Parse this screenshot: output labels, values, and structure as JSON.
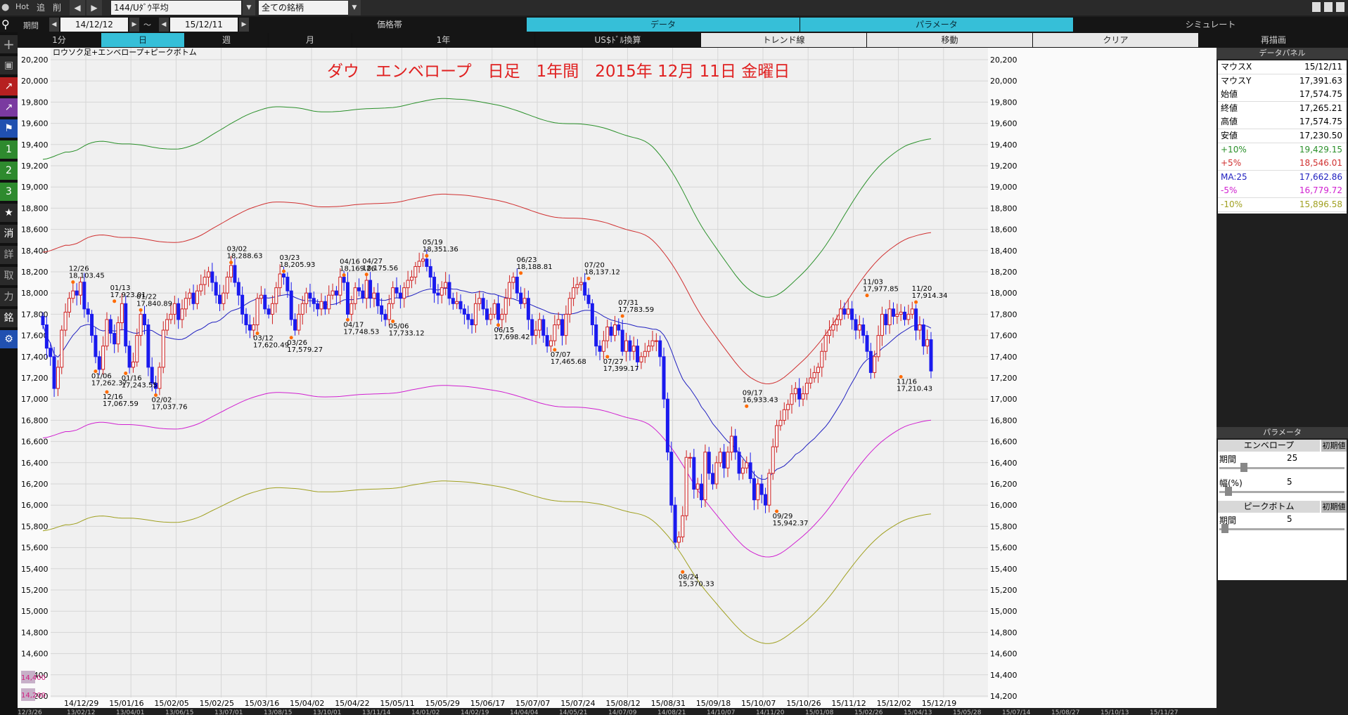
{
  "toolbar": {
    "hot": "Hot",
    "add": "追",
    "del": "削",
    "kikan": "期間",
    "date_from": "14/12/12",
    "tilde": "～",
    "date_to": "15/12/11",
    "symbol": "144/Uﾀﾞｳ平均",
    "universe": "全ての銘柄",
    "top_tabs": [
      "価格帯",
      "データ",
      "パラメータ",
      "シミュレート"
    ],
    "period_tabs": [
      "1分",
      "日",
      "週",
      "月",
      "1年",
      "US$ﾄﾞﾙ換算",
      "トレンド線",
      "移動",
      "クリア",
      "再描画"
    ]
  },
  "colors": {
    "accent": "#2fb8d2",
    "up": "#d02020",
    "down": "#1a1aee",
    "env10": "#2a902a",
    "env5": "#d03030",
    "ma": "#2020c0",
    "envm5": "#d020d0",
    "envm10": "#a0a020",
    "title": "#e02020"
  },
  "chart": {
    "legend": "ロウソク足+エンベロープ+ピークボトム",
    "title": "ダウ　エンベロープ　日足　1年間　2015年 12月 11日 金曜日",
    "y_ticks": [
      "20,200",
      "20,000",
      "19,800",
      "19,600",
      "19,400",
      "19,200",
      "19,000",
      "18,800",
      "18,600",
      "18,400",
      "18,200",
      "18,000",
      "17,800",
      "17,600",
      "17,400",
      "17,200",
      "17,000",
      "16,800",
      "16,600",
      "16,400",
      "16,200",
      "16,000",
      "15,800",
      "15,600",
      "15,400",
      "15,200",
      "15,000",
      "14,800",
      "14,600",
      "14,400",
      "14,200"
    ],
    "x_ticks": [
      "14/12/29",
      "15/01/16",
      "15/02/05",
      "15/02/25",
      "15/03/16",
      "15/04/02",
      "15/04/22",
      "15/05/11",
      "15/05/29",
      "15/06/17",
      "15/07/07",
      "15/07/24",
      "15/08/12",
      "15/08/31",
      "15/09/18",
      "15/10/07",
      "15/10/26",
      "15/11/12",
      "15/12/02",
      "15/12/19"
    ],
    "overview_ticks": [
      "12/3/26",
      "13/02/12",
      "13/04/01",
      "13/06/15",
      "13/07/01",
      "13/08/15",
      "13/10/01",
      "13/11/14",
      "14/01/02",
      "14/02/19",
      "14/04/04",
      "14/05/21",
      "14/07/09",
      "14/08/21",
      "14/10/07",
      "14/11/20",
      "15/01/08",
      "15/02/26",
      "15/04/13",
      "15/05/28",
      "15/07/14",
      "15/08/27",
      "15/10/13",
      "15/11/27"
    ],
    "scroll_labels": [
      "14,400",
      "14,200"
    ]
  },
  "chart_data": {
    "type": "candlestick",
    "ylim": [
      14200,
      20300
    ],
    "annotations": [
      {
        "d": "12/16",
        "v": "17,067.59",
        "x": 17,
        "y": 17067,
        "p": "b"
      },
      {
        "d": "12/26",
        "v": "18,103.45",
        "x": 8,
        "y": 18103,
        "p": "t"
      },
      {
        "d": "01/06",
        "v": "17,262.37",
        "x": 14,
        "y": 17262,
        "p": "b"
      },
      {
        "d": "01/13",
        "v": "17,923.01",
        "x": 19,
        "y": 17923,
        "p": "t"
      },
      {
        "d": "01/16",
        "v": "17,243.55",
        "x": 22,
        "y": 17243,
        "p": "b"
      },
      {
        "d": "01/22",
        "v": "17,840.89",
        "x": 26,
        "y": 17840,
        "p": "t"
      },
      {
        "d": "02/02",
        "v": "17,037.76",
        "x": 30,
        "y": 17037,
        "p": "b"
      },
      {
        "d": "03/02",
        "v": "18,288.63",
        "x": 50,
        "y": 18288,
        "p": "t"
      },
      {
        "d": "03/12",
        "v": "17,620.49",
        "x": 57,
        "y": 17620,
        "p": "b"
      },
      {
        "d": "03/23",
        "v": "18,205.93",
        "x": 64,
        "y": 18205,
        "p": "t"
      },
      {
        "d": "03/26",
        "v": "17,579.27",
        "x": 66,
        "y": 17579,
        "p": "b"
      },
      {
        "d": "04/16",
        "v": "18,169.26",
        "x": 80,
        "y": 18169,
        "p": "t"
      },
      {
        "d": "04/17",
        "v": "17,748.53",
        "x": 81,
        "y": 17748,
        "p": "b"
      },
      {
        "d": "04/27",
        "v": "18,175.56",
        "x": 86,
        "y": 18175,
        "p": "t"
      },
      {
        "d": "05/06",
        "v": "17,733.12",
        "x": 93,
        "y": 17733,
        "p": "b"
      },
      {
        "d": "05/19",
        "v": "18,351.36",
        "x": 102,
        "y": 18351,
        "p": "t"
      },
      {
        "d": "06/15",
        "v": "17,698.42",
        "x": 121,
        "y": 17698,
        "p": "b"
      },
      {
        "d": "06/23",
        "v": "18,188.81",
        "x": 127,
        "y": 18188,
        "p": "t"
      },
      {
        "d": "07/07",
        "v": "17,465.68",
        "x": 136,
        "y": 17465,
        "p": "b"
      },
      {
        "d": "07/20",
        "v": "18,137.12",
        "x": 145,
        "y": 18137,
        "p": "t"
      },
      {
        "d": "07/27",
        "v": "17,399.17",
        "x": 150,
        "y": 17399,
        "p": "b"
      },
      {
        "d": "07/31",
        "v": "17,783.59",
        "x": 154,
        "y": 17783,
        "p": "t"
      },
      {
        "d": "08/24",
        "v": "15,370.33",
        "x": 170,
        "y": 15370,
        "p": "b"
      },
      {
        "d": "09/17",
        "v": "16,933.43",
        "x": 187,
        "y": 16933,
        "p": "t"
      },
      {
        "d": "09/29",
        "v": "15,942.37",
        "x": 195,
        "y": 15942,
        "p": "b"
      },
      {
        "d": "11/03",
        "v": "17,977.85",
        "x": 219,
        "y": 17977,
        "p": "t"
      },
      {
        "d": "11/16",
        "v": "17,210.43",
        "x": 228,
        "y": 17210,
        "p": "b"
      },
      {
        "d": "11/20",
        "v": "17,914.34",
        "x": 232,
        "y": 17914,
        "p": "t"
      }
    ],
    "closes": [
      17700,
      17480,
      17400,
      17100,
      17300,
      17650,
      17820,
      17950,
      18020,
      17980,
      18103,
      17850,
      17800,
      17600,
      17400,
      17280,
      17500,
      17750,
      17620,
      17520,
      17720,
      17900,
      17500,
      17300,
      17350,
      17600,
      17800,
      17700,
      17300,
      17150,
      17100,
      17300,
      17650,
      17750,
      17800,
      17900,
      17750,
      17850,
      17950,
      18000,
      17900,
      18020,
      18080,
      18150,
      18200,
      18100,
      17980,
      17900,
      18000,
      18150,
      18260,
      18100,
      17980,
      17800,
      17700,
      17650,
      17700,
      17950,
      17980,
      17850,
      17800,
      17900,
      18050,
      18180,
      18150,
      18020,
      17750,
      17650,
      17800,
      17900,
      18000,
      17950,
      17900,
      17850,
      17920,
      17850,
      17980,
      18020,
      17980,
      18150,
      18100,
      17800,
      17900,
      18050,
      18020,
      17950,
      18120,
      17950,
      18000,
      17880,
      17800,
      17750,
      17900,
      18050,
      18000,
      17950,
      18050,
      18120,
      18150,
      18250,
      18300,
      18320,
      18250,
      18150,
      18000,
      17980,
      18050,
      18100,
      17950,
      17900,
      17920,
      17850,
      17800,
      17750,
      17700,
      17900,
      17950,
      17850,
      17750,
      17800,
      17900,
      17750,
      17800,
      17950,
      18100,
      18150,
      18000,
      17900,
      17950,
      17750,
      17600,
      17650,
      17750,
      17600,
      17500,
      17550,
      17700,
      17750,
      17600,
      17800,
      17950,
      18050,
      18080,
      18100,
      17980,
      17900,
      17700,
      17500,
      17450,
      17550,
      17680,
      17600,
      17700,
      17650,
      17450,
      17550,
      17450,
      17500,
      17350,
      17400,
      17450,
      17500,
      17550,
      17550,
      17400,
      17000,
      16500,
      16000,
      15650,
      15700,
      15900,
      16450,
      16450,
      16150,
      16200,
      16050,
      16500,
      16300,
      16200,
      16400,
      16500,
      16350,
      16500,
      16650,
      16500,
      16300,
      16350,
      16400,
      16250,
      16050,
      16200,
      16100,
      16000,
      16300,
      16550,
      16750,
      16800,
      16900,
      16950,
      17050,
      17100,
      17000,
      17050,
      17150,
      17200,
      17250,
      17300,
      17450,
      17600,
      17650,
      17700,
      17750,
      17850,
      17800,
      17850,
      17750,
      17650,
      17700,
      17600,
      17450,
      17250,
      17400,
      17600,
      17800,
      17700,
      17850,
      17780,
      17800,
      17820,
      17750,
      17800,
      17850,
      17650,
      17700,
      17500,
      17560,
      17265
    ]
  },
  "data_panel": {
    "title": "データパネル",
    "rows": [
      {
        "label": "マウスX",
        "value": "15/12/11",
        "color": "#000"
      },
      {
        "label": "マウスY",
        "value": "17,391.63",
        "color": "#000"
      },
      {
        "label": "始値",
        "value": "17,574.75",
        "color": "#000"
      },
      {
        "label": "終値",
        "value": "17,265.21",
        "color": "#000"
      },
      {
        "label": "高値",
        "value": "17,574.75",
        "color": "#000"
      },
      {
        "label": "安値",
        "value": "17,230.50",
        "color": "#000"
      },
      {
        "label": "+10%",
        "value": "19,429.15",
        "color": "#2a902a"
      },
      {
        "label": "+5%",
        "value": "18,546.01",
        "color": "#d03030"
      },
      {
        "label": "MA:25",
        "value": "17,662.86",
        "color": "#2020c0"
      },
      {
        "label": "-5%",
        "value": "16,779.72",
        "color": "#d020d0"
      },
      {
        "label": "-10%",
        "value": "15,896.58",
        "color": "#a0a020"
      }
    ]
  },
  "param_panel": {
    "title": "パラメータ",
    "envelope": "エンベロープ",
    "reset": "初期値",
    "period_label": "期間",
    "period_value": "25",
    "width_label": "幅(%)",
    "width_value": "5",
    "peak": "ピークボトム",
    "reset2": "初期値",
    "peak_period_label": "期間",
    "peak_period_value": "5",
    "period_slider": 0.18,
    "width_slider": 0.05,
    "peak_slider": 0.02
  },
  "sidebar": [
    "search-icon",
    "plus-icon",
    "camera-icon",
    "chart-red-icon",
    "chart-purple-icon",
    "flag-icon",
    "1",
    "2",
    "3",
    "★",
    "消",
    "詳",
    "取",
    "力",
    "銘",
    "gear-icon"
  ]
}
